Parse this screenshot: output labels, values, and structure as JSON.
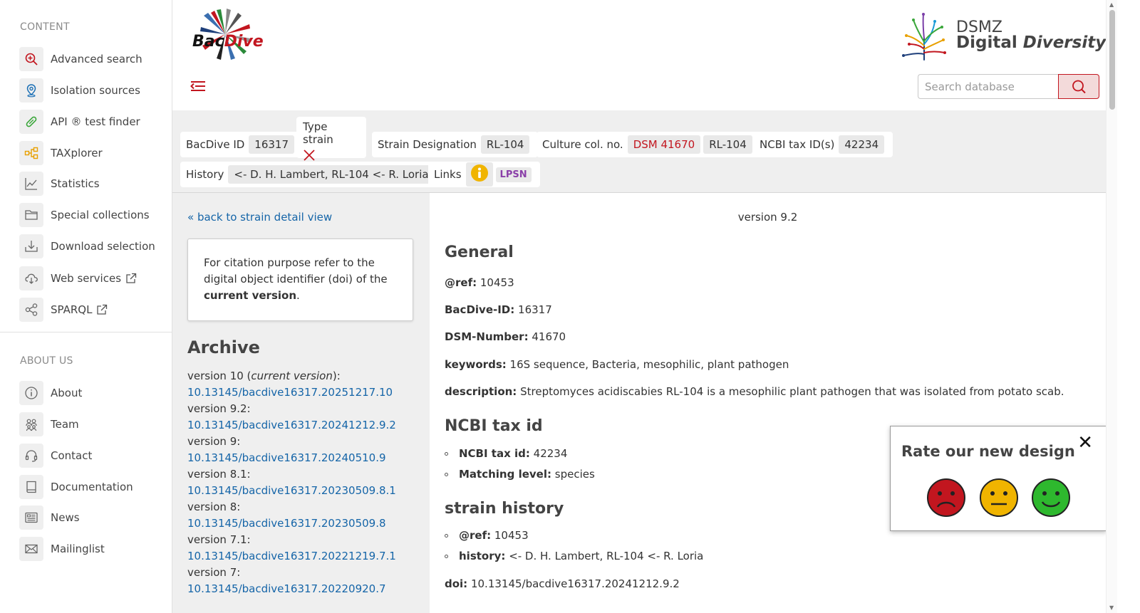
{
  "sidebar": {
    "content_title": "CONTENT",
    "content_items": [
      {
        "label": "Advanced search",
        "icon": "search-plus-icon"
      },
      {
        "label": "Isolation sources",
        "icon": "map-pin-icon"
      },
      {
        "label": "API ® test finder",
        "icon": "pill-icon"
      },
      {
        "label": "TAXplorer",
        "icon": "hierarchy-icon"
      },
      {
        "label": "Statistics",
        "icon": "chart-line-icon"
      },
      {
        "label": "Special collections",
        "icon": "folder-icon"
      },
      {
        "label": "Download selection",
        "icon": "download-icon"
      },
      {
        "label": "Web services",
        "icon": "cloud-download-icon"
      },
      {
        "label": "SPARQL",
        "icon": "share-nodes-icon"
      }
    ],
    "about_title": "ABOUT US",
    "about_items": [
      {
        "label": "About",
        "icon": "info-icon"
      },
      {
        "label": "Team",
        "icon": "team-icon"
      },
      {
        "label": "Contact",
        "icon": "headset-icon"
      },
      {
        "label": "Documentation",
        "icon": "book-icon"
      },
      {
        "label": "News",
        "icon": "newspaper-icon"
      },
      {
        "label": "Mailinglist",
        "icon": "envelope-icon"
      }
    ]
  },
  "header": {
    "logo_text_a": "Bac",
    "logo_text_b": "Dive",
    "partner_line1": "DSMZ",
    "partner_line2a": "Digital ",
    "partner_line2b": "Diversity",
    "search_placeholder": "Search database"
  },
  "info_bar": {
    "bacdive_id_label": "BacDive ID",
    "bacdive_id_value": "16317",
    "type_strain_label": "Type strain",
    "strain_designation_label": "Strain Designation",
    "strain_designation_value": "RL-104",
    "culture_col_label": "Culture col. no.",
    "culture_col_values": [
      "DSM 41670",
      "RL-104"
    ],
    "ncbi_label": "NCBI tax ID(s)",
    "ncbi_value": "42234",
    "history_label": "History",
    "history_value": "<- D. H. Lambert, RL-104 <- R. Loria",
    "links_label": "Links",
    "lpsn_label": "LPSN"
  },
  "left_column": {
    "back_link": "« back to strain detail view",
    "citation_text_a": "For citation purpose refer to the digital object identifier (doi) of the ",
    "citation_text_bold": "current version",
    "citation_text_c": ".",
    "archive_title": "Archive",
    "versions": [
      {
        "label": "version 10 (",
        "label_italic": "current version",
        "label_end": "):",
        "doi": "10.13145/bacdive16317.20251217.10"
      },
      {
        "label": "version 9.2:",
        "label_italic": "",
        "label_end": "",
        "doi": "10.13145/bacdive16317.20241212.9.2"
      },
      {
        "label": "version 9:",
        "label_italic": "",
        "label_end": "",
        "doi": "10.13145/bacdive16317.20240510.9"
      },
      {
        "label": "version 8.1:",
        "label_italic": "",
        "label_end": "",
        "doi": "10.13145/bacdive16317.20230509.8.1"
      },
      {
        "label": "version 8:",
        "label_italic": "",
        "label_end": "",
        "doi": "10.13145/bacdive16317.20230509.8"
      },
      {
        "label": "version 7.1:",
        "label_italic": "",
        "label_end": "",
        "doi": "10.13145/bacdive16317.20221219.7.1"
      },
      {
        "label": "version 7:",
        "label_italic": "",
        "label_end": "",
        "doi": "10.13145/bacdive16317.20220920.7"
      }
    ]
  },
  "main": {
    "version_heading": "version 9.2",
    "general_title": "General",
    "ref_label": "@ref:",
    "ref_value": "10453",
    "bacdive_label": "BacDive-ID:",
    "bacdive_value": "16317",
    "dsm_label": "DSM-Number:",
    "dsm_value": "41670",
    "keywords_label": "keywords:",
    "keywords_value": "16S sequence, Bacteria, mesophilic, plant pathogen",
    "description_label": "description:",
    "description_value": "Streptomyces acidiscabies RL-104 is a mesophilic plant pathogen that was isolated from potato scab.",
    "ncbi_title": "NCBI tax id",
    "ncbi_tax_label": "NCBI tax id:",
    "ncbi_tax_value": "42234",
    "matching_label": "Matching level:",
    "matching_value": "species",
    "history_title": "strain history",
    "history_ref_label": "@ref:",
    "history_ref_value": "10453",
    "history_label": "history:",
    "history_value": "<- D. H. Lambert, RL-104 <- R. Loria",
    "doi_label": "doi:",
    "doi_value": "10.13145/bacdive16317.20241212.9.2"
  },
  "rating": {
    "title": "Rate our new design",
    "close": "✕",
    "colors": {
      "bad": "#c2161f",
      "neutral": "#f0b400",
      "good": "#2eb82e"
    }
  },
  "colors": {
    "accent": "#c2161f",
    "link": "#1565a8",
    "panel": "#efefef"
  }
}
